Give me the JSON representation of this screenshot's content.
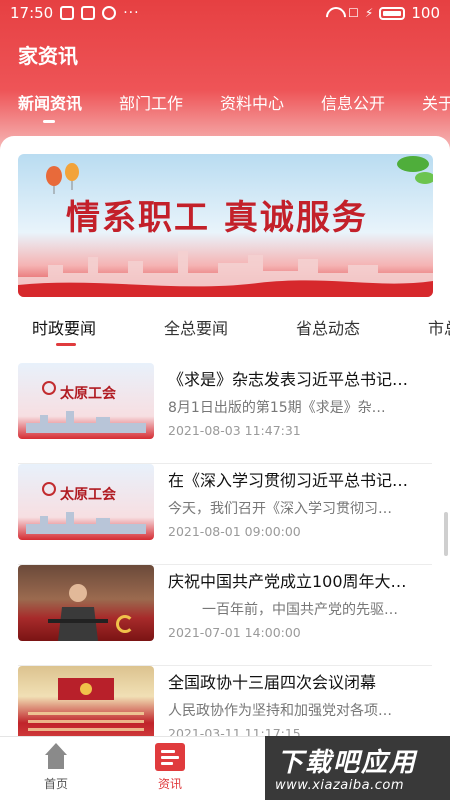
{
  "status_bar": {
    "time": "17:50",
    "battery": "100",
    "more": "···"
  },
  "app": {
    "title": "家资讯"
  },
  "nav": {
    "tabs": [
      "新闻资讯",
      "部门工作",
      "资料中心",
      "信息公开",
      "关于"
    ]
  },
  "banner": {
    "slogan": "情系职工 真诚服务"
  },
  "subtabs": [
    "时政要闻",
    "全总要闻",
    "省总动态",
    "市总"
  ],
  "news": [
    {
      "title": "《求是》杂志发表习近平总书记…",
      "summary": "8月1日出版的第15期《求是》杂…",
      "date": "2021-08-03 11:47:31",
      "thumb_label": "太原工会"
    },
    {
      "title": "在《深入学习贯彻习近平总书记…",
      "summary": "今天，我们召开《深入学习贯彻习…",
      "date": "2021-08-01 09:00:00",
      "thumb_label": "太原工会"
    },
    {
      "title": "庆祝中国共产党成立100周年大…",
      "summary": "一百年前，中国共产党的先驱…",
      "date": "2021-07-01 14:00:00",
      "thumb_label": ""
    },
    {
      "title": "全国政协十三届四次会议闭幕",
      "summary": "人民政协作为坚持和加强党对各项…",
      "date": "2021-03-11 11:17:15",
      "thumb_label": ""
    }
  ],
  "bottom_nav": [
    {
      "label": "首页",
      "icon": "home-icon"
    },
    {
      "label": "资讯",
      "icon": "news-icon"
    }
  ],
  "watermark": {
    "big": "下载吧应用",
    "small": "www.xiazaiba.com"
  },
  "colors": {
    "brand_red": "#e03b3d",
    "header_red": "#e64042"
  }
}
